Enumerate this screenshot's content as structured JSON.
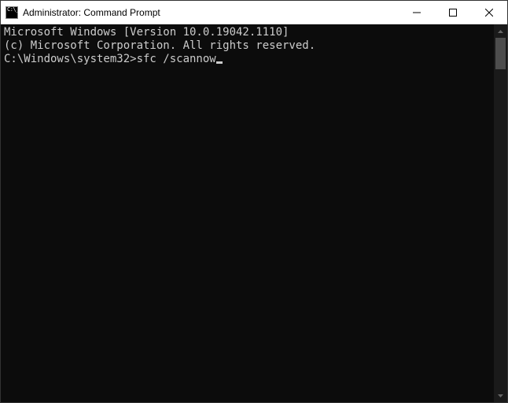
{
  "window": {
    "title": "Administrator: Command Prompt"
  },
  "terminal": {
    "line1": "Microsoft Windows [Version 10.0.19042.1110]",
    "line2": "(c) Microsoft Corporation. All rights reserved.",
    "blank": "",
    "prompt": "C:\\Windows\\system32>",
    "command": "sfc /scannow"
  }
}
